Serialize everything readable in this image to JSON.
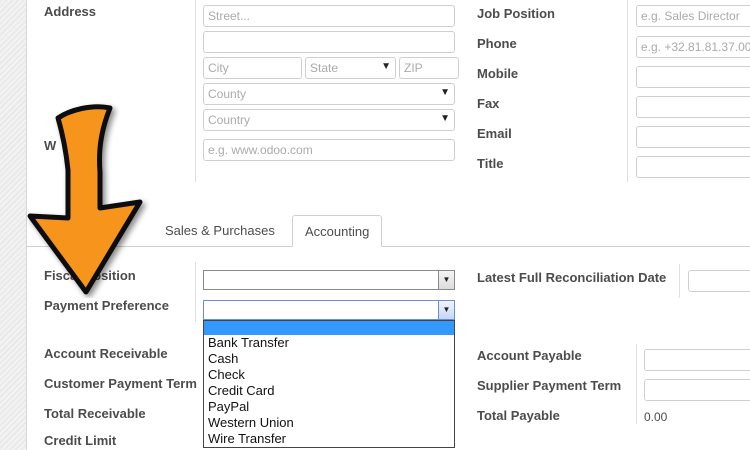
{
  "address": {
    "label": "Address",
    "street_placeholder": "Street...",
    "street2_placeholder": "",
    "city_placeholder": "City",
    "state_placeholder": "State",
    "zip_placeholder": "ZIP",
    "county_placeholder": "County",
    "country_placeholder": "Country"
  },
  "website": {
    "label": "W",
    "placeholder": "e.g. www.odoo.com"
  },
  "contact": {
    "job_position": {
      "label": "Job Position",
      "placeholder": "e.g. Sales Director"
    },
    "phone": {
      "label": "Phone",
      "placeholder": "e.g. +32.81.81.37.00"
    },
    "mobile": {
      "label": "Mobile"
    },
    "fax": {
      "label": "Fax"
    },
    "email": {
      "label": "Email"
    },
    "title": {
      "label": "Title"
    }
  },
  "tabs": [
    {
      "label": "Sales & Purchases",
      "active": false
    },
    {
      "label": "Accounting",
      "active": true
    }
  ],
  "accounting": {
    "fiscal_position_label": "Fiscal Position",
    "payment_preference_label": "Payment Preference",
    "payment_options": [
      "",
      "Bank Transfer",
      "Cash",
      "Check",
      "Credit Card",
      "PayPal",
      "Western Union",
      "Wire Transfer"
    ],
    "latest_reconciliation_label": "Latest Full Reconciliation Date",
    "account_receivable_label": "Account Receivable",
    "customer_payment_term_label": "Customer Payment Term",
    "total_receivable_label": "Total Receivable",
    "credit_limit_label": "Credit Limit",
    "account_payable_label": "Account Payable",
    "supplier_payment_term_label": "Supplier Payment Term",
    "total_payable_label": "Total Payable",
    "total_payable_value": "0.00"
  },
  "colors": {
    "arrow": "#f7941d",
    "highlight": "#3399ff"
  }
}
